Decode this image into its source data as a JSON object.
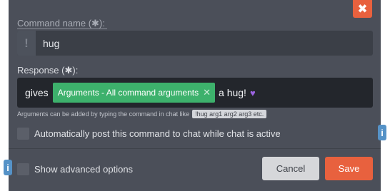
{
  "dialog": {
    "close_label": "✖",
    "command_name": {
      "label": "Command name (",
      "required_mark": "✱",
      "label_end": "):",
      "prefix_icon": "!",
      "value": "hug"
    },
    "response": {
      "label": "Response (",
      "required_mark": "✱",
      "label_end": "):",
      "text_before": "gives",
      "chip_label": "Arguments - All command arguments",
      "chip_remove": "✕",
      "text_after": "a hug!",
      "emoji": "♥"
    },
    "hint": {
      "text": "Arguments can be added by typing the command in chat like",
      "example": "!hug arg1 arg2 arg3 etc."
    },
    "auto_post_label": "Automatically post this command to chat while chat is active",
    "advanced_label": "Show advanced options",
    "cancel_label": "Cancel",
    "save_label": "Save",
    "info_icon": "i"
  },
  "colors": {
    "panel": "#4b4f59",
    "accent": "#e8613e",
    "chip": "#3db16c",
    "input_dark": "#23262c"
  }
}
